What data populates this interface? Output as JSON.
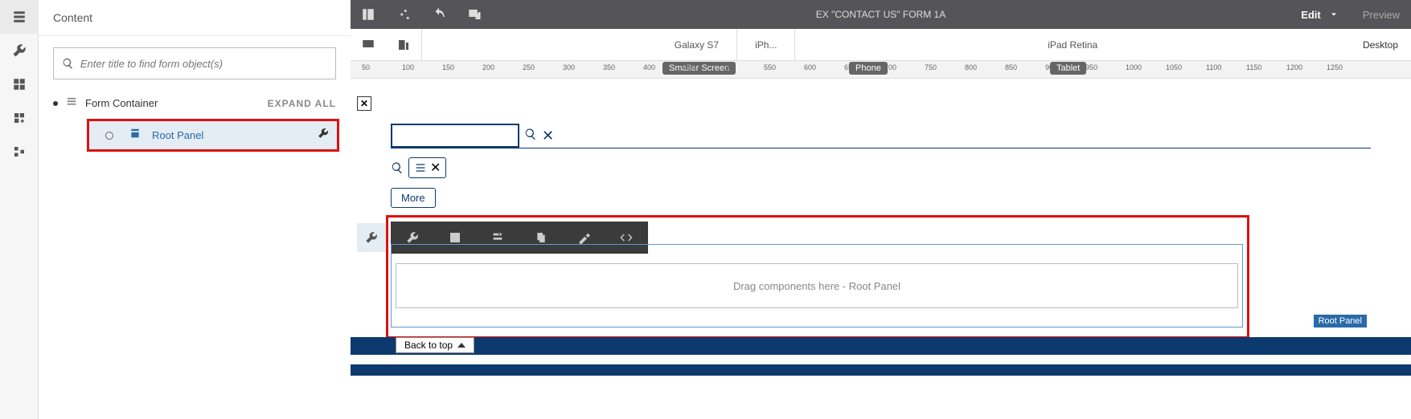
{
  "sidebar": {
    "title": "Content",
    "search_placeholder": "Enter title to find form object(s)",
    "form_container": "Form Container",
    "expand_all": "EXPAND ALL",
    "root_panel": "Root Panel"
  },
  "topbar": {
    "title": "EX \"CONTACT US\" FORM 1A",
    "edit": "Edit",
    "preview": "Preview"
  },
  "devices": {
    "galaxy": "Galaxy S7",
    "iphone": "iPh...",
    "ipad": "iPad Retina",
    "desktop": "Desktop"
  },
  "breakpoints": {
    "smaller": "Smaller Screen",
    "phone": "Phone",
    "tablet": "Tablet"
  },
  "ruler_ticks": [
    "50",
    "100",
    "150",
    "200",
    "250",
    "300",
    "350",
    "400",
    "450",
    "500",
    "550",
    "600",
    "650",
    "700",
    "750",
    "800",
    "850",
    "900",
    "950",
    "1000",
    "1050",
    "1100",
    "1150",
    "1200",
    "1250"
  ],
  "canvas": {
    "more": "More",
    "drop_text": "Drag components here - Root Panel",
    "panel_tag": "Root Panel",
    "back_top": "Back to top"
  }
}
